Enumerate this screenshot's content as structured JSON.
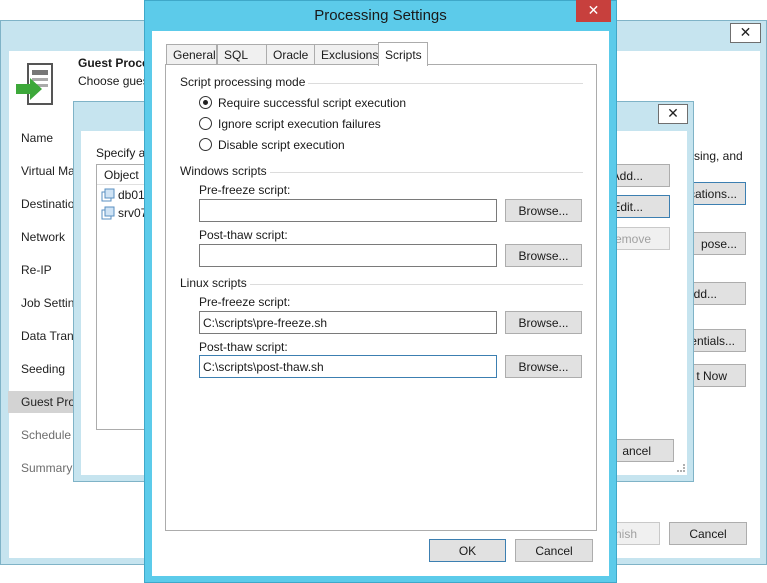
{
  "wizard": {
    "header_title": "Guest Proce",
    "header_subtitle": "Choose gues",
    "right_text": "sing, and",
    "nav": [
      {
        "label": "Name"
      },
      {
        "label": "Virtual Ma"
      },
      {
        "label": "Destinatio"
      },
      {
        "label": "Network"
      },
      {
        "label": "Re-IP"
      },
      {
        "label": "Job Settin"
      },
      {
        "label": "Data Tran"
      },
      {
        "label": "Seeding"
      },
      {
        "label": "Guest Pro"
      },
      {
        "label": "Schedule"
      },
      {
        "label": "Summary"
      }
    ],
    "buttons": {
      "applications": "cations...",
      "choose": "pose...",
      "add": "dd...",
      "credentials": "entials...",
      "test_now": "t Now",
      "finish": "nish",
      "cancel": "Cancel"
    },
    "close_glyph": "✕"
  },
  "mid_dialog": {
    "label": "Specify a",
    "column_header": "Object",
    "rows": [
      {
        "name": "db01"
      },
      {
        "name": "srv07"
      }
    ],
    "buttons": {
      "add": "Add...",
      "edit": "Edit...",
      "remove": "emove",
      "cancel": "ancel"
    },
    "close_glyph": "✕"
  },
  "processing": {
    "title": "Processing Settings",
    "close_glyph": "✕",
    "tabs": [
      {
        "label": "General"
      },
      {
        "label": "SQL"
      },
      {
        "label": "Oracle"
      },
      {
        "label": "Exclusions"
      },
      {
        "label": "Scripts"
      }
    ],
    "mode": {
      "title": "Script processing mode",
      "options": [
        {
          "label": "Require successful script execution",
          "selected": true
        },
        {
          "label": "Ignore script execution failures",
          "selected": false
        },
        {
          "label": "Disable script execution",
          "selected": false
        }
      ]
    },
    "windows": {
      "title": "Windows scripts",
      "pre_label": "Pre-freeze script:",
      "pre_value": "",
      "post_label": "Post-thaw script:",
      "post_value": ""
    },
    "linux": {
      "title": "Linux scripts",
      "pre_label": "Pre-freeze script:",
      "pre_value": "C:\\scripts\\pre-freeze.sh",
      "post_label": "Post-thaw script:",
      "post_value": "C:\\scripts\\post-thaw.sh"
    },
    "browse_label": "Browse...",
    "ok_label": "OK",
    "cancel_label": "Cancel"
  },
  "colors": {
    "frame": "#c6e4ef",
    "title_bar": "#5ccbea",
    "accent": "#3c7fb1",
    "nav_selected": "#d3d3d3",
    "folder_icon": "#5a8fc0"
  }
}
